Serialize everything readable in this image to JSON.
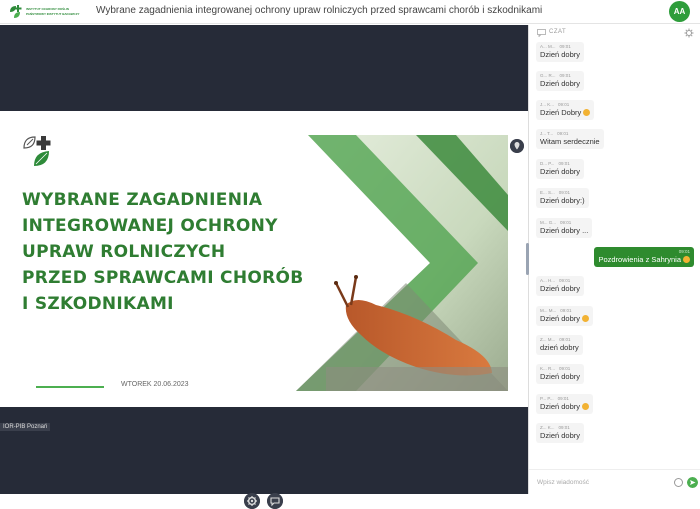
{
  "header": {
    "logo_line1": "INSTYTUT OCHRONY ROŚLIN",
    "logo_line2": "PAŃSTWOWY INSTYTUT BADAWCZY",
    "title": "Wybrane zagadnienia integrowanej ochrony upraw rolniczych przed sprawcami chorób i szkodnikami",
    "avatar_initials": "AA"
  },
  "slide": {
    "heading_lines": [
      "WYBRANE ZAGADNIENIA",
      "INTEGROWANEJ OCHRONY",
      "UPRAW ROLNICZYCH",
      "PRZED SPRAWCAMI CHORÓB",
      "I SZKODNIKAMI"
    ],
    "date": "WTOREK 20.06.2023",
    "presenter_label": "IOR-PIB Poznań"
  },
  "chat": {
    "title": "CZAT",
    "input_placeholder": "Wpisz wiadomość",
    "messages": [
      {
        "author": "A... M...",
        "time": "09:01",
        "text": "Dzień dobry",
        "emoji": false,
        "own": false
      },
      {
        "author": "G... R...",
        "time": "09:01",
        "text": "Dzień dobry",
        "emoji": false,
        "own": false
      },
      {
        "author": "J... K...",
        "time": "09:01",
        "text": "Dzień Dobry",
        "emoji": true,
        "own": false
      },
      {
        "author": "J... T...",
        "time": "09:01",
        "text": "Witam serdecznie",
        "emoji": false,
        "own": false
      },
      {
        "author": "D... P...",
        "time": "09:01",
        "text": "Dzień dobry",
        "emoji": false,
        "own": false
      },
      {
        "author": "E... S...",
        "time": "09:01",
        "text": "Dzień dobry:)",
        "emoji": false,
        "own": false
      },
      {
        "author": "M... G...",
        "time": "09:01",
        "text": "Dzień dobry ...",
        "emoji": false,
        "own": false
      },
      {
        "author": "",
        "time": "09:01",
        "text": "Pozdrowienia z Sahrynia",
        "emoji": true,
        "own": true
      },
      {
        "author": "A... H...",
        "time": "09:01",
        "text": "Dzień dobry",
        "emoji": false,
        "own": false
      },
      {
        "author": "M... M...",
        "time": "09:01",
        "text": "Dzień dobry",
        "emoji": true,
        "own": false
      },
      {
        "author": "Z... M...",
        "time": "09:01",
        "text": "dzień dobry",
        "emoji": false,
        "own": false
      },
      {
        "author": "K... R...",
        "time": "09:01",
        "text": "Dzień dobry",
        "emoji": false,
        "own": false
      },
      {
        "author": "P... P...",
        "time": "09:01",
        "text": "Dzień dobry",
        "emoji": true,
        "own": false
      },
      {
        "author": "Z... K...",
        "time": "09:01",
        "text": "Dzień dobry",
        "emoji": false,
        "own": false
      }
    ]
  },
  "colors": {
    "brand_green": "#2e8b2e",
    "heading_green": "#2f7d32",
    "stage_bg": "#262b38"
  },
  "icons": [
    "institute-logo-icon",
    "avatar-icon",
    "location-pin-icon",
    "settings-gear-icon",
    "chat-bubble-icon",
    "chat-icon",
    "emoji-icon",
    "send-icon"
  ]
}
